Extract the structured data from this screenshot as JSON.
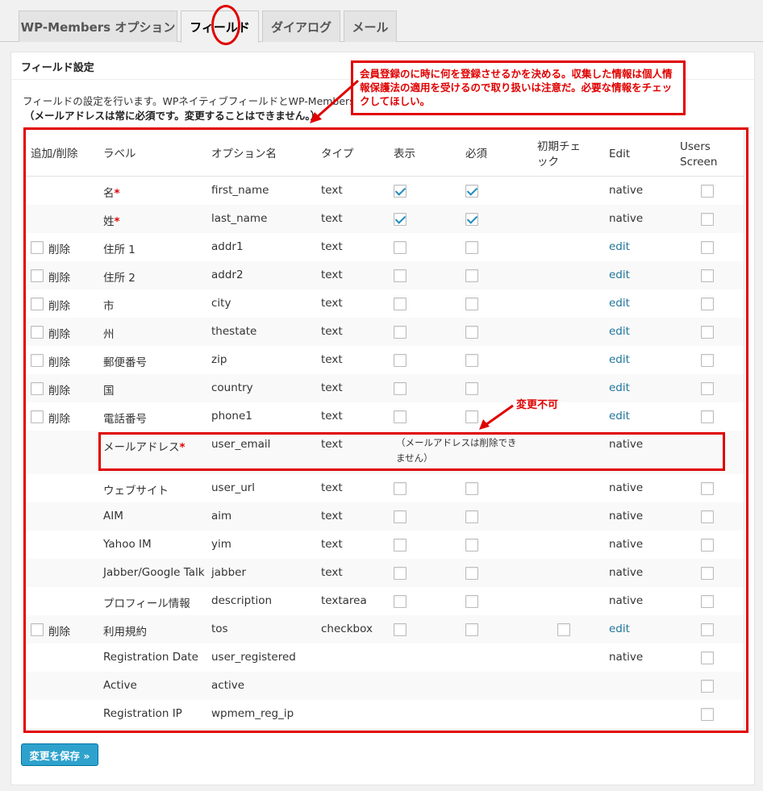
{
  "tabs": [
    {
      "label": "WP-Members オプション"
    },
    {
      "label": "フィールド"
    },
    {
      "label": "ダイアログ"
    },
    {
      "label": "メール"
    }
  ],
  "panel": {
    "title": "フィールド設定",
    "description": "フィールドの設定を行います。WPネイティブフィールドとWP-Membersカスタムフィールドの両方が含まれます。",
    "email_note": "（メールアドレスは常に必須です。変更することはできません。）"
  },
  "table": {
    "headers": {
      "add_remove": "追加/削除",
      "label": "ラベル",
      "option_name": "オプション名",
      "type": "タイプ",
      "display": "表示",
      "required": "必須",
      "checked": "初期チェック",
      "edit": "Edit",
      "users_screen": "Users Screen"
    },
    "rows": [
      {
        "delete": "",
        "label": "名",
        "req": "*",
        "option": "first_name",
        "type": "text",
        "edit": "native"
      },
      {
        "delete": "",
        "label": "姓",
        "req": "*",
        "option": "last_name",
        "type": "text",
        "edit": "native"
      },
      {
        "delete": "削除",
        "label": "住所 1",
        "req": "",
        "option": "addr1",
        "type": "text",
        "edit": "edit"
      },
      {
        "delete": "削除",
        "label": "住所 2",
        "req": "",
        "option": "addr2",
        "type": "text",
        "edit": "edit"
      },
      {
        "delete": "削除",
        "label": "市",
        "req": "",
        "option": "city",
        "type": "text",
        "edit": "edit"
      },
      {
        "delete": "削除",
        "label": "州",
        "req": "",
        "option": "thestate",
        "type": "text",
        "edit": "edit"
      },
      {
        "delete": "削除",
        "label": "郵便番号",
        "req": "",
        "option": "zip",
        "type": "text",
        "edit": "edit"
      },
      {
        "delete": "削除",
        "label": "国",
        "req": "",
        "option": "country",
        "type": "text",
        "edit": "edit"
      },
      {
        "delete": "削除",
        "label": "電話番号",
        "req": "",
        "option": "phone1",
        "type": "text",
        "edit": "edit"
      },
      {
        "delete": "",
        "label": "メールアドレス",
        "req": "*",
        "option": "user_email",
        "type": "text",
        "edit": "native",
        "note": "（メールアドレスは削除できません）"
      },
      {
        "delete": "",
        "label": "ウェブサイト",
        "req": "",
        "option": "user_url",
        "type": "text",
        "edit": "native"
      },
      {
        "delete": "",
        "label": "AIM",
        "req": "",
        "option": "aim",
        "type": "text",
        "edit": "native"
      },
      {
        "delete": "",
        "label": "Yahoo IM",
        "req": "",
        "option": "yim",
        "type": "text",
        "edit": "native"
      },
      {
        "delete": "",
        "label": "Jabber/Google Talk",
        "req": "",
        "option": "jabber",
        "type": "text",
        "edit": "native"
      },
      {
        "delete": "",
        "label": "プロフィール情報",
        "req": "",
        "option": "description",
        "type": "textarea",
        "edit": "native"
      },
      {
        "delete": "削除",
        "label": "利用規約",
        "req": "",
        "option": "tos",
        "type": "checkbox",
        "edit": "edit"
      },
      {
        "delete": "",
        "label": "Registration Date",
        "req": "",
        "option": "user_registered",
        "type": "",
        "edit": "native"
      },
      {
        "delete": "",
        "label": "Active",
        "req": "",
        "option": "active",
        "type": "",
        "edit": ""
      },
      {
        "delete": "",
        "label": "Registration IP",
        "req": "",
        "option": "wpmem_reg_ip",
        "type": "",
        "edit": ""
      }
    ]
  },
  "annotations": {
    "callout": "会員登録のに時に何を登録させるかを決める。収集した情報は個人情報保護法の適用を受けるので取り扱いは注意だ。必要な情報をチェックしてほしい。",
    "fixed": "変更不可"
  },
  "buttons": {
    "save": "変更を保存 »"
  },
  "colors": {
    "annotation": "#e00000",
    "primary": "#2ea2cc",
    "link": "#21759b"
  }
}
